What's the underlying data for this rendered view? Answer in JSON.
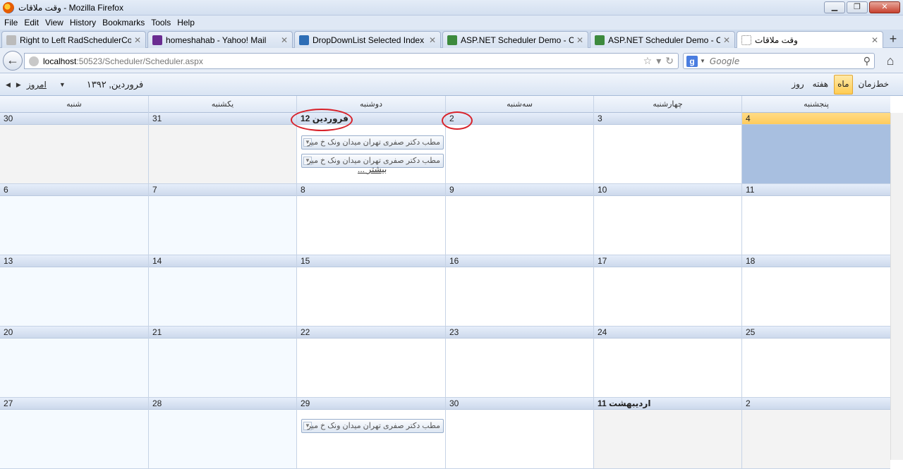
{
  "window": {
    "title": "وقت ملاقات - Mozilla Firefox",
    "min": "▁",
    "max": "❐",
    "close": "✕"
  },
  "menu": [
    "File",
    "Edit",
    "View",
    "History",
    "Bookmarks",
    "Tools",
    "Help"
  ],
  "tabs": [
    {
      "label": "Right to Left RadSchedulerCo...",
      "icon_color": "#888888"
    },
    {
      "label": "homeshahab - Yahoo! Mail",
      "icon_color": "#6a2c91"
    },
    {
      "label": "DropDownList Selected Index ...",
      "icon_color": "#2d6db5"
    },
    {
      "label": "ASP.NET Scheduler Demo - C...",
      "icon_color": "#3d8a3d"
    },
    {
      "label": "ASP.NET Scheduler Demo - C...",
      "icon_color": "#3d8a3d"
    },
    {
      "label": "وقت ملاقات",
      "icon_color": "#ffffff"
    }
  ],
  "nav": {
    "url_host": "localhost",
    "url_path": ":50523/Scheduler/Scheduler.aspx",
    "search_placeholder": "Google",
    "search_engine_letter": "g"
  },
  "scheduler": {
    "views": [
      "خط‌زمان",
      "ماه",
      "هفته",
      "روز"
    ],
    "selected_view": "ماه",
    "today_label": "امروز",
    "date_label": "فروردین, ۱۳۹۲",
    "days_of_week": [
      "پنجشنبه",
      "چهارشنبه",
      "سه‌شنبه",
      "دوشنبه",
      "یکشنبه",
      "شنبه"
    ],
    "weeks": [
      [
        "4",
        "3",
        "2",
        "فروردین 12",
        "31",
        "30"
      ],
      [
        "11",
        "10",
        "9",
        "8",
        "7",
        "6"
      ],
      [
        "18",
        "17",
        "16",
        "15",
        "14",
        "13"
      ],
      [
        "25",
        "24",
        "23",
        "22",
        "21",
        "20"
      ],
      [
        "2",
        "اردیبهشت 11",
        "30",
        "29",
        "28",
        "27"
      ]
    ],
    "appointment_text": "مطب دکتر صفری تهران میدان ونک خ میر",
    "more_label": "... بیشتر"
  }
}
